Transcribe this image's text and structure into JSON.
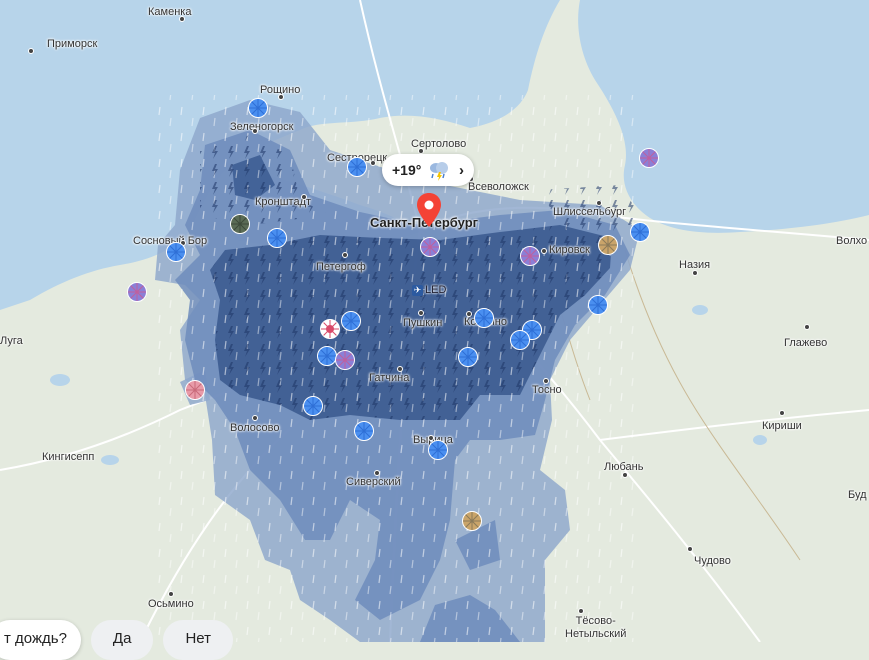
{
  "colors": {
    "water": "#b7d4ea",
    "land": "#e4eadf",
    "forest": "#d4e2c8",
    "rain_light": "#8ea7cc",
    "rain_medium": "#6f8cbc",
    "rain_heavy": "#3b5a90",
    "pin": "#f44336"
  },
  "cities": [
    {
      "id": "kamenka",
      "name": "Каменка"
    },
    {
      "id": "primorsk",
      "name": "Приморск"
    },
    {
      "id": "roshchino",
      "name": "Рощино"
    },
    {
      "id": "zelenogorsk",
      "name": "Зеленогорск"
    },
    {
      "id": "sertolovo",
      "name": "Сертолово"
    },
    {
      "id": "sestroretsk",
      "name": "Сестрорецк"
    },
    {
      "id": "vsevolozhsk",
      "name": "Всеволожск"
    },
    {
      "id": "kronshtadt",
      "name": "Кронштадт"
    },
    {
      "id": "spb",
      "name": "Санкт-Петербург",
      "big": true
    },
    {
      "id": "shlisselburg",
      "name": "Шлиссельбург"
    },
    {
      "id": "sosnovy_bor",
      "name": "Сосновый Бор"
    },
    {
      "id": "kirovsk",
      "name": "Кировск"
    },
    {
      "id": "volkhov",
      "name": "Волхо"
    },
    {
      "id": "petergof",
      "name": "Петергоф"
    },
    {
      "id": "naziya",
      "name": "Назия"
    },
    {
      "id": "pushkin",
      "name": "Пушкин"
    },
    {
      "id": "kolpino",
      "name": "Колпино"
    },
    {
      "id": "luga",
      "name": "Луга"
    },
    {
      "id": "glazhevo",
      "name": "Глажево"
    },
    {
      "id": "gatchina",
      "name": "Гатчина"
    },
    {
      "id": "tosno",
      "name": "Тосно"
    },
    {
      "id": "volosovo",
      "name": "Волосово"
    },
    {
      "id": "kirishi",
      "name": "Кириши"
    },
    {
      "id": "vyritsa",
      "name": "Вырица"
    },
    {
      "id": "kingisepp",
      "name": "Кингисепп"
    },
    {
      "id": "lyuban",
      "name": "Любань"
    },
    {
      "id": "siversky",
      "name": "Сиверский"
    },
    {
      "id": "bud",
      "name": "Буд"
    },
    {
      "id": "chudovo",
      "name": "Чудово"
    },
    {
      "id": "osmino",
      "name": "Осьмино"
    },
    {
      "id": "tesovo",
      "name": "Тёсово-\nНетыльский"
    }
  ],
  "weather": {
    "temperature": "+19°",
    "icon": "cloud-rain-thunder-icon",
    "chevron": "›"
  },
  "airport": {
    "code": "LED",
    "icon": "airplane-icon"
  },
  "bottom": {
    "question": "т дождь?",
    "yes_label": "Да",
    "no_label": "Нет"
  },
  "user_markers": [
    {
      "type": "blue-umbrella"
    },
    {
      "type": "blue-umbrella"
    },
    {
      "type": "blue-umbrella"
    },
    {
      "type": "blue-umbrella"
    },
    {
      "type": "blue-umbrella"
    },
    {
      "type": "blue-umbrella"
    },
    {
      "type": "blue-umbrella"
    },
    {
      "type": "blue-umbrella"
    },
    {
      "type": "blue-umbrella"
    },
    {
      "type": "blue-umbrella"
    },
    {
      "type": "blue-umbrella"
    },
    {
      "type": "blue-umbrella"
    },
    {
      "type": "blue-umbrella"
    },
    {
      "type": "blue-umbrella"
    },
    {
      "type": "blue-umbrella"
    },
    {
      "type": "purple-umbrella"
    },
    {
      "type": "purple-umbrella"
    },
    {
      "type": "purple-umbrella"
    },
    {
      "type": "purple-umbrella"
    },
    {
      "type": "purple-umbrella"
    },
    {
      "type": "gold-umbrella"
    },
    {
      "type": "gold-umbrella"
    },
    {
      "type": "dark-umbrella"
    },
    {
      "type": "heart-umbrella"
    },
    {
      "type": "pink-umbrella"
    }
  ]
}
